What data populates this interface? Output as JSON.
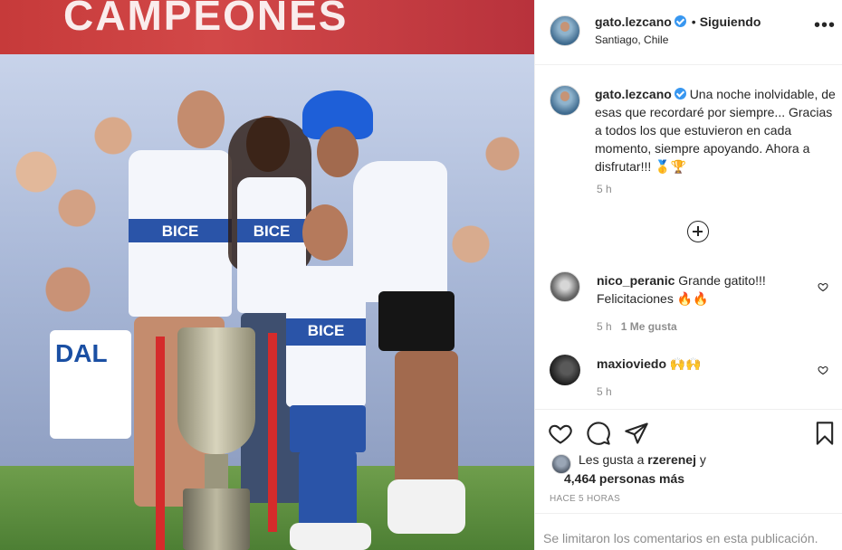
{
  "header": {
    "username": "gato.lezcano",
    "separator": "•",
    "follow_label": "Siguiendo",
    "location": "Santiago, Chile",
    "more_label": "•••"
  },
  "caption": {
    "username": "gato.lezcano",
    "text": "Una noche inolvidable, de esas que recordaré por siempre... Gracias a todos los que estuvieron en cada momento, siempre apoyando. Ahora a disfrutar!!! 🥇🏆",
    "time": "5 h"
  },
  "comments": [
    {
      "username": "nico_peranic",
      "text": "Grande gatito!!! Felicitaciones 🔥🔥",
      "time": "5 h",
      "likes": "1 Me gusta"
    },
    {
      "username": "maxioviedo",
      "text": "🙌🙌",
      "time": "5 h"
    }
  ],
  "likes": {
    "prefix": "Les gusta a",
    "user": "rzerenej",
    "joiner": "y",
    "count_text": "4,464 personas más"
  },
  "posted": "HACE 5 HORAS",
  "limited_notice": "Se limitaron los comentarios en esta publicación.",
  "photo": {
    "banner_text": "CAMPEONES",
    "shirt_text": "BICE",
    "sign_text": "DAL"
  },
  "colors": {
    "verified": "#3897f0",
    "text": "#262626",
    "secondary": "#8e8e8e",
    "border": "#efefef"
  },
  "icons": [
    "more-icon",
    "load-more-icon",
    "heart-icon",
    "comment-icon",
    "share-icon",
    "bookmark-icon",
    "verified-icon"
  ]
}
